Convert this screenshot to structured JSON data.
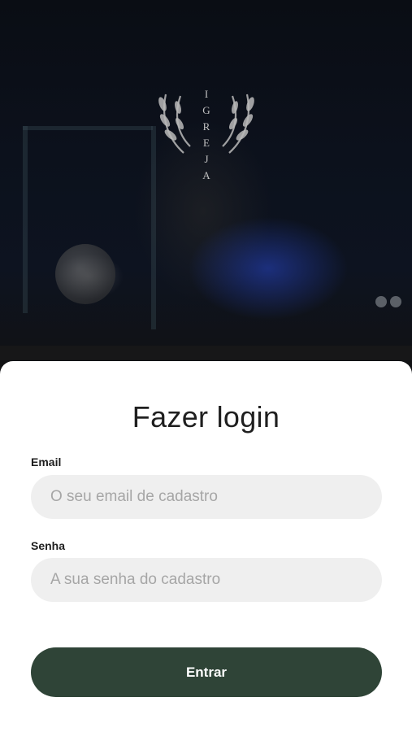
{
  "hero": {
    "logo_letters": [
      "I",
      "G",
      "R",
      "E",
      "J",
      "A"
    ]
  },
  "login": {
    "title": "Fazer login",
    "email_label": "Email",
    "email_placeholder": "O seu email de cadastro",
    "email_value": "",
    "password_label": "Senha",
    "password_placeholder": "A sua senha do cadastro",
    "password_value": "",
    "submit_label": "Entrar"
  },
  "colors": {
    "primary_button": "#2f4437",
    "input_background": "#efefef",
    "sheet_background": "#ffffff",
    "backdrop": "#0b0f18"
  }
}
